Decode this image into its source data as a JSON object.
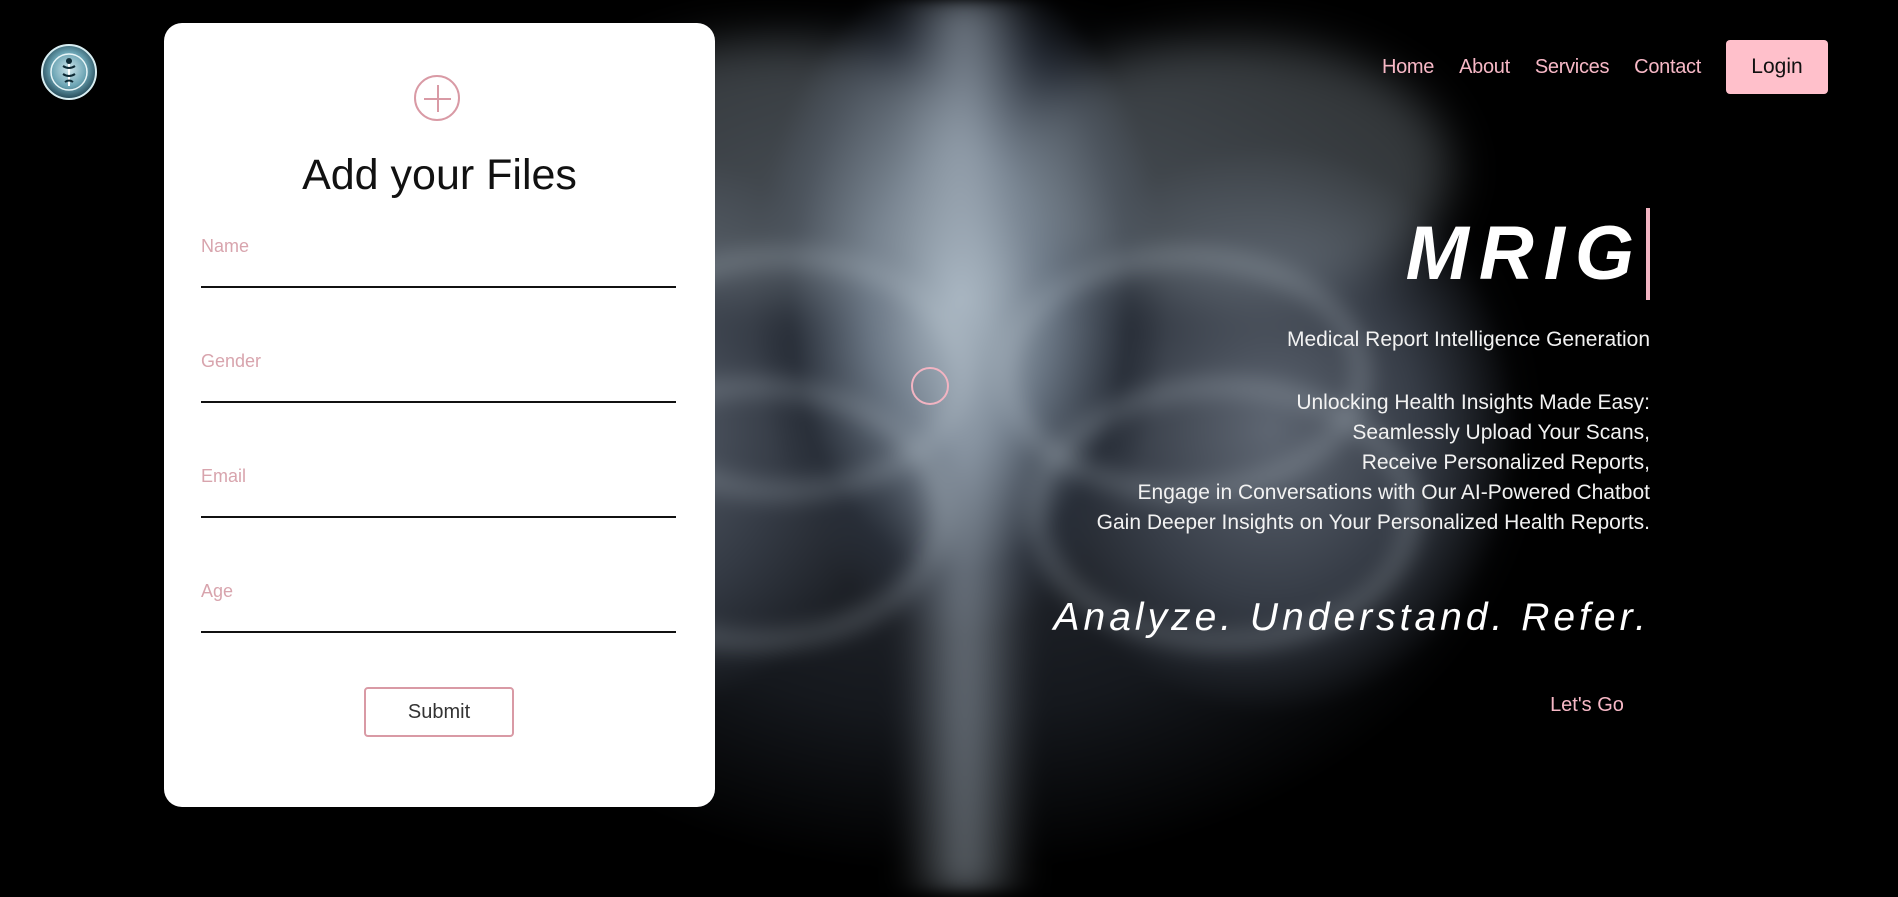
{
  "nav": {
    "items": [
      "Home",
      "About",
      "Services",
      "Contact"
    ],
    "login_label": "Login"
  },
  "form": {
    "title": "Add your Files",
    "fields": [
      {
        "label": "Name"
      },
      {
        "label": "Gender"
      },
      {
        "label": "Email"
      },
      {
        "label": "Age"
      }
    ],
    "submit_label": "Submit"
  },
  "hero": {
    "brand": "MRIG",
    "subtitle": "Medical Report Intelligence Generation",
    "description_lines": [
      "Unlocking Health Insights Made Easy:",
      "Seamlessly Upload Your Scans,",
      "Receive Personalized Reports,",
      "Engage in Conversations with Our AI-Powered Chatbot",
      "Gain Deeper Insights on Your Personalized Health Reports."
    ],
    "tagline": "Analyze. Understand. Refer.",
    "cta_label": "Let's Go"
  },
  "colors": {
    "accent_pink": "#ffc0cb",
    "nav_link": "#f7b8c6",
    "card_background": "#ffffff"
  },
  "icons": {
    "logo": "caduceus-logo-icon",
    "add_file": "plus-circle-icon",
    "cursor_ring": "cursor-ring-icon"
  }
}
